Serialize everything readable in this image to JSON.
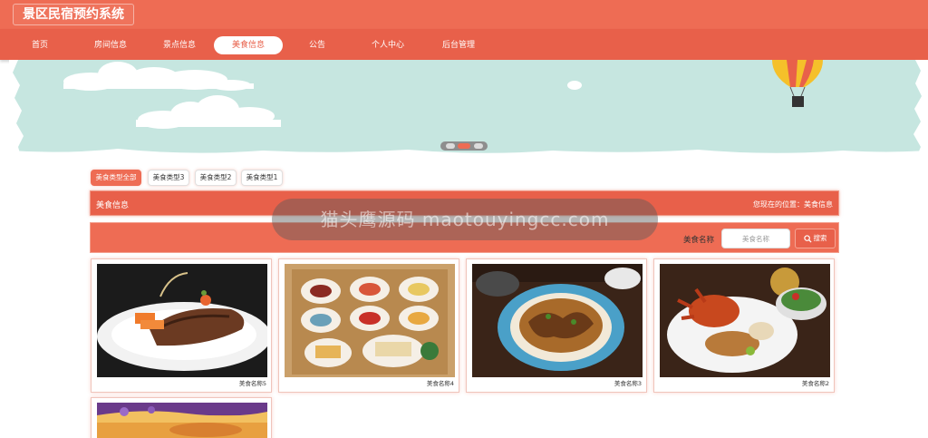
{
  "header": {
    "site_title": "景区民宿预约系统",
    "nav": [
      {
        "label": "首页",
        "active": false
      },
      {
        "label": "房间信息",
        "active": false
      },
      {
        "label": "景点信息",
        "active": false
      },
      {
        "label": "美食信息",
        "active": true
      },
      {
        "label": "公告",
        "active": false
      },
      {
        "label": "个人中心",
        "active": false
      },
      {
        "label": "后台管理",
        "active": false
      }
    ]
  },
  "banner": {
    "dots": 3,
    "active_dot": 2
  },
  "filters": {
    "tabs": [
      {
        "label": "美食类型全部",
        "active": true
      },
      {
        "label": "美食类型3",
        "active": false
      },
      {
        "label": "美食类型2",
        "active": false
      },
      {
        "label": "美食类型1",
        "active": false
      }
    ]
  },
  "section": {
    "title": "美食信息",
    "breadcrumb_prefix": "您现在的位置：",
    "breadcrumb_current": "美食信息"
  },
  "search": {
    "label": "美食名称",
    "placeholder": "美食名称",
    "button_label": "搜索"
  },
  "foods": [
    {
      "name": "美食名称5",
      "image": "steak-plate"
    },
    {
      "name": "美食名称4",
      "image": "dim-sum-tray"
    },
    {
      "name": "美食名称3",
      "image": "noodle-bowl"
    },
    {
      "name": "美食名称2",
      "image": "crab-platter"
    },
    {
      "name": "",
      "image": "dessert-plate"
    }
  ],
  "watermark": {
    "text": "猫头鹰源码 maotouyingcc.com"
  },
  "colors": {
    "primary": "#ee6c54",
    "primary_dark": "#e8604a",
    "banner_sky": "#c6e6e0"
  }
}
